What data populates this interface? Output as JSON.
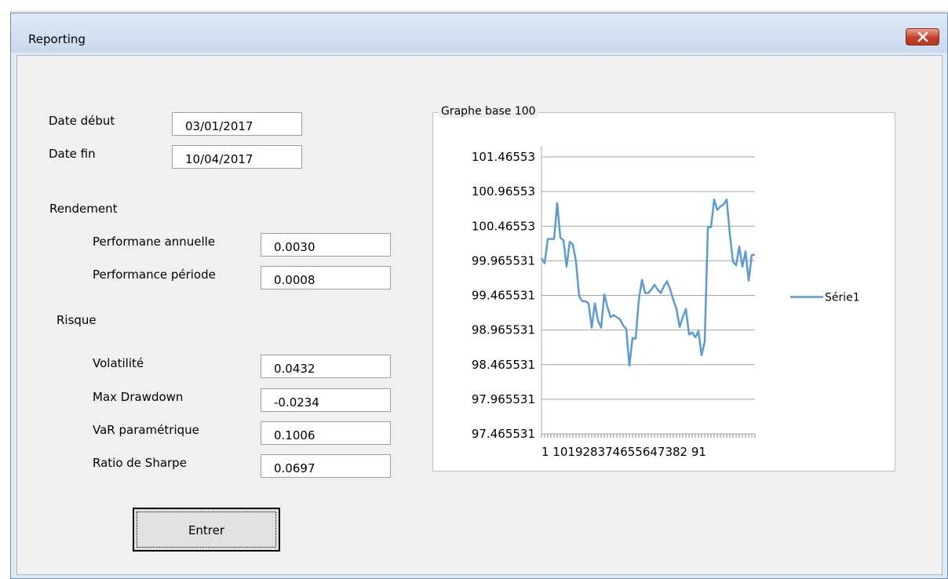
{
  "window": {
    "title": "Reporting"
  },
  "form": {
    "date_debut": {
      "label": "Date début",
      "value": "03/01/2017"
    },
    "date_fin": {
      "label": "Date fin",
      "value": "10/04/2017"
    },
    "rendement": {
      "label": "Rendement",
      "perf_annuelle": {
        "label": "Performane annuelle",
        "value": "0.0030"
      },
      "perf_periode": {
        "label": "Performance période",
        "value": "0.0008"
      }
    },
    "risque": {
      "label": "Risque",
      "volatilite": {
        "label": "Volatilité",
        "value": "0.0432"
      },
      "max_drawdown": {
        "label": "Max Drawdown",
        "value": "-0.0234"
      },
      "var_parametrique": {
        "label": "VaR paramétrique",
        "value": "0.1006"
      },
      "ratio_sharpe": {
        "label": "Ratio de Sharpe",
        "value": "0.0697"
      }
    },
    "enter_label": "Entrer"
  },
  "chart_frame_title": "Graphe base 100",
  "chart_data": {
    "type": "line",
    "y_ticks": [
      "101.46553",
      "100.96553",
      "100.46553",
      "99.965531",
      "99.465531",
      "98.965531",
      "98.465531",
      "97.965531",
      "97.465531"
    ],
    "ylim": [
      97.465531,
      101.46553
    ],
    "x_tick_labels": "1 101928374655647382 91",
    "legend_position": "right",
    "series": [
      {
        "name": "Série1",
        "color": "#5b9bd5",
        "values": [
          100.0,
          99.93,
          100.28,
          100.28,
          100.28,
          100.8,
          100.3,
          100.26,
          99.88,
          100.24,
          100.2,
          99.95,
          99.45,
          99.38,
          99.38,
          99.35,
          99.0,
          99.35,
          99.1,
          99.0,
          99.48,
          99.3,
          99.15,
          99.18,
          99.15,
          99.12,
          99.03,
          98.98,
          98.45,
          98.85,
          98.84,
          99.4,
          99.69,
          99.5,
          99.5,
          99.55,
          99.62,
          99.55,
          99.5,
          99.6,
          99.67,
          99.55,
          99.4,
          99.27,
          99.01,
          99.15,
          99.27,
          98.9,
          98.93,
          98.86,
          98.95,
          98.6,
          98.8,
          100.45,
          100.45,
          100.85,
          100.7,
          100.75,
          100.78,
          100.85,
          100.35,
          99.95,
          99.9,
          100.17,
          99.88,
          100.1,
          99.68,
          100.05,
          100.05
        ]
      }
    ]
  }
}
